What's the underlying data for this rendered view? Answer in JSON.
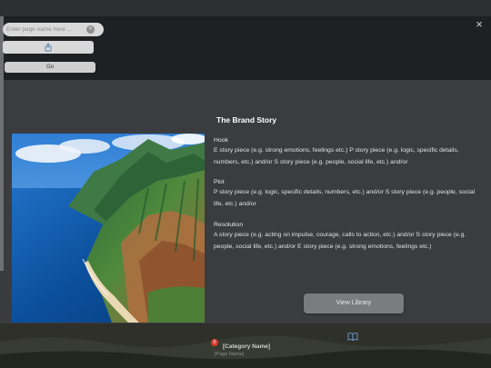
{
  "modal": {
    "close_symbol": "×"
  },
  "navigation": {
    "page_input_placeholder": "Enter page name here ...",
    "clear_symbol": "✕",
    "go_label": "Go",
    "share_icon": "share-icon"
  },
  "story": {
    "title": "The Brand Story",
    "sections": [
      {
        "heading": "Hook",
        "text": "E story piece (e.g. strong emotions, feelings etc.) P story piece (e.g. logic, specific details, numbers, etc.) and/or S story piece (e.g. people, social life, etc.) and/or"
      },
      {
        "heading": "Plot",
        "text": "P story piece (e.g. logic, specific details, numbers, etc.) and/or S story piece (e.g. people, social life, etc.) and/or"
      },
      {
        "heading": "Resolution",
        "text": "A story piece (e.g. acting on impulse, courage, calls to action, etc.) and/or S story piece (e.g. people, social life, etc.) and/or E story piece (e.g. strong emotions, feelings etc.)"
      }
    ],
    "view_library_label": "View Library"
  },
  "footer": {
    "badge_count": "0",
    "category_name": "[Category Name]",
    "page_name": "[Page Name]"
  },
  "colors": {
    "accent_badge": "#d83a2e",
    "modal_body": "#3b3c3f",
    "modal_header": "#1f2023"
  }
}
